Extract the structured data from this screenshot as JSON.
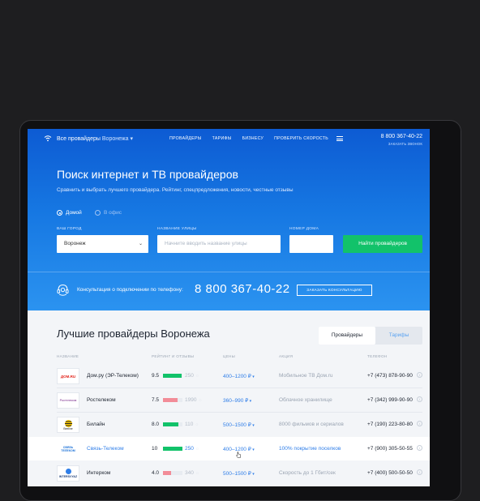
{
  "nav": {
    "region_prefix": "Все провайдеры",
    "region_city": "Воронежа",
    "links": [
      "ПРОВАЙДЕРЫ",
      "ТАРИФЫ",
      "БИЗНЕСУ",
      "ПРОВЕРИТЬ СКОРОСТЬ"
    ],
    "phone": "8 800 367-40-22",
    "callback": "ЗАКАЗАТЬ ЗВОНОК"
  },
  "hero": {
    "title": "Поиск интернет и ТВ провайдеров",
    "subtitle": "Сравнить и выбрать лучшего провайдера. Рейтинг, спецпредложения, новости, честные отзывы",
    "radio_home": "Домой",
    "radio_office": "В офис",
    "city_label": "ВАШ ГОРОД",
    "city_value": "Воронеж",
    "street_label": "НАЗВАНИЕ УЛИЦЫ",
    "street_placeholder": "Начните вводить название улицы",
    "house_label": "НОМЕР ДОМА",
    "house_value": "",
    "find_button": "Найти провайдеров"
  },
  "consult": {
    "text": "Консультация о подключении по телефону:",
    "phone": "8 800 367-40-22",
    "button": "ЗАКАЗАТЬ КОНСУЛЬТАЦИЮ"
  },
  "providers": {
    "title": "Лучшие провайдеры Воронежа",
    "tab_active": "Провайдеры",
    "tab_inactive": "Тарифы",
    "columns": [
      "НАЗВАНИЕ",
      "РЕЙТИНГ И ОТЗЫВЫ",
      "ЦЕНЫ",
      "АКЦИЯ",
      "ТЕЛЕФОН"
    ],
    "rows": [
      {
        "logo": "ДОМ.RU",
        "name": "Дом.ру (ЭР-Телеком)",
        "rating": "9.5",
        "rating_frac": 0.95,
        "reviews": "250",
        "price": "400–1200 ₽",
        "promo": "Мобильное ТВ Дом.ru",
        "phone": "+7 (473) 878-90-90"
      },
      {
        "logo": "Ростелеком",
        "name": "Ростелеком",
        "rating": "7.5",
        "rating_frac": 0.75,
        "reviews": "1990",
        "price": "360–990 ₽",
        "promo": "Облачное хранилище",
        "phone": "+7 (342) 999-90-90"
      },
      {
        "logo": "Beeline",
        "name": "Билайн",
        "rating": "8.0",
        "rating_frac": 0.8,
        "reviews": "110",
        "price": "500–1500 ₽",
        "promo": "8000 фильмов и сериалов",
        "phone": "+7 (190) 223-80-80"
      },
      {
        "logo": "СВЯЗЬ ТЕЛЕКОМ",
        "name": "Связь-Телеком",
        "rating": "10",
        "rating_frac": 1.0,
        "reviews": "250",
        "price": "400–1200 ₽",
        "promo": "100% покрытие поселков",
        "phone": "+7 (900) 305-50-55"
      },
      {
        "logo": "INTERSVYAZ",
        "name": "Интерком",
        "rating": "4.0",
        "rating_frac": 0.4,
        "reviews": "340",
        "price": "500–1500 ₽",
        "promo": "Скорость до 1 Гбит/сек",
        "phone": "+7 (400) 500-50-50"
      }
    ]
  },
  "colors": {
    "hero": "#0d5bd3",
    "accent": "#2f7ee8",
    "green": "#12c26a",
    "bar_good": "#12c26a",
    "bar_mid": "#f28c98"
  }
}
